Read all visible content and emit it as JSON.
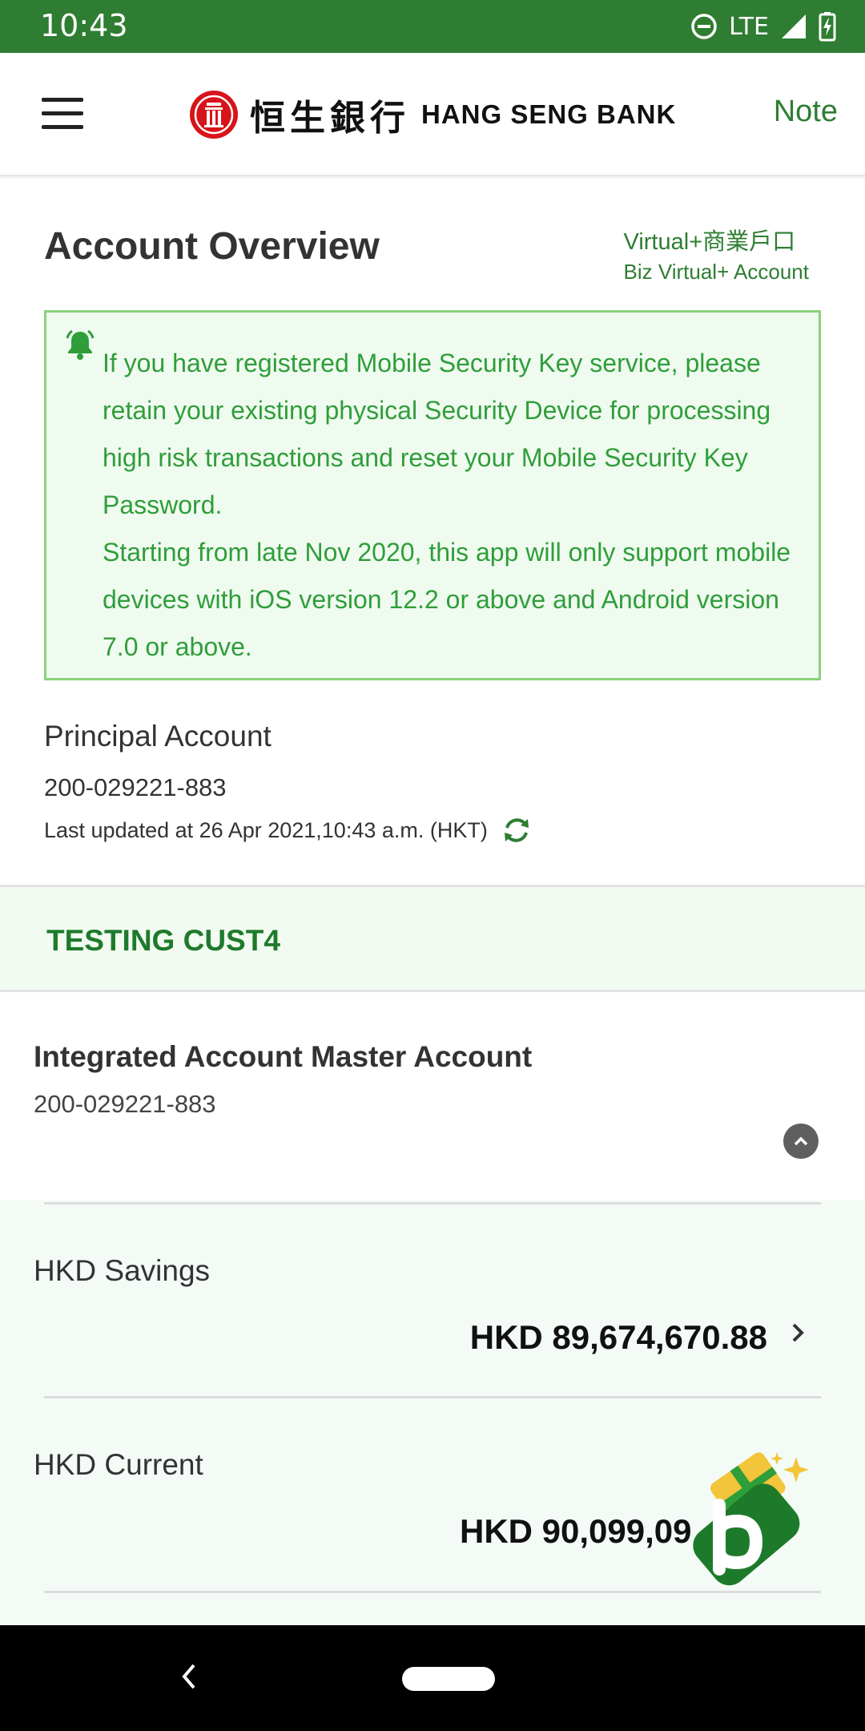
{
  "status_bar": {
    "time": "10:43",
    "network": "LTE",
    "icons": [
      "do-not-disturb-icon",
      "signal-icon",
      "battery-charging-icon"
    ]
  },
  "header": {
    "brand_chinese": "恒生銀行",
    "brand_english": "HANG SENG BANK",
    "note_label": "Note",
    "icons": [
      "menu-icon",
      "hang-seng-logo"
    ]
  },
  "overview": {
    "title": "Account Overview",
    "account_type_line1": "Virtual+商業戶口",
    "account_type_line2": "Biz Virtual+ Account",
    "notice": "If you have registered Mobile Security Key service, please retain your existing physical Security Device for processing high risk transactions and reset your Mobile Security Key Password.\nStarting from late Nov 2020, this app will only support mobile devices with iOS version 12.2 or above and Android version 7.0 or above.",
    "principal_label": "Principal Account",
    "principal_number": "200-029221-883",
    "last_updated": "Last updated at 26 Apr 2021,10:43 a.m. (HKT)"
  },
  "customer": {
    "name": "TESTING CUST4"
  },
  "master_account": {
    "title": "Integrated Account Master Account",
    "number": "200-029221-883"
  },
  "accounts": [
    {
      "name": "HKD Savings",
      "balance": "HKD 89,674,670.88"
    },
    {
      "name": "HKD Current",
      "balance": "HKD 90,099,09"
    }
  ],
  "colors": {
    "brand_green": "#2e7d32",
    "notice_text": "#2f9e3a",
    "notice_border": "#8bd17c",
    "logo_red": "#d7141a"
  }
}
